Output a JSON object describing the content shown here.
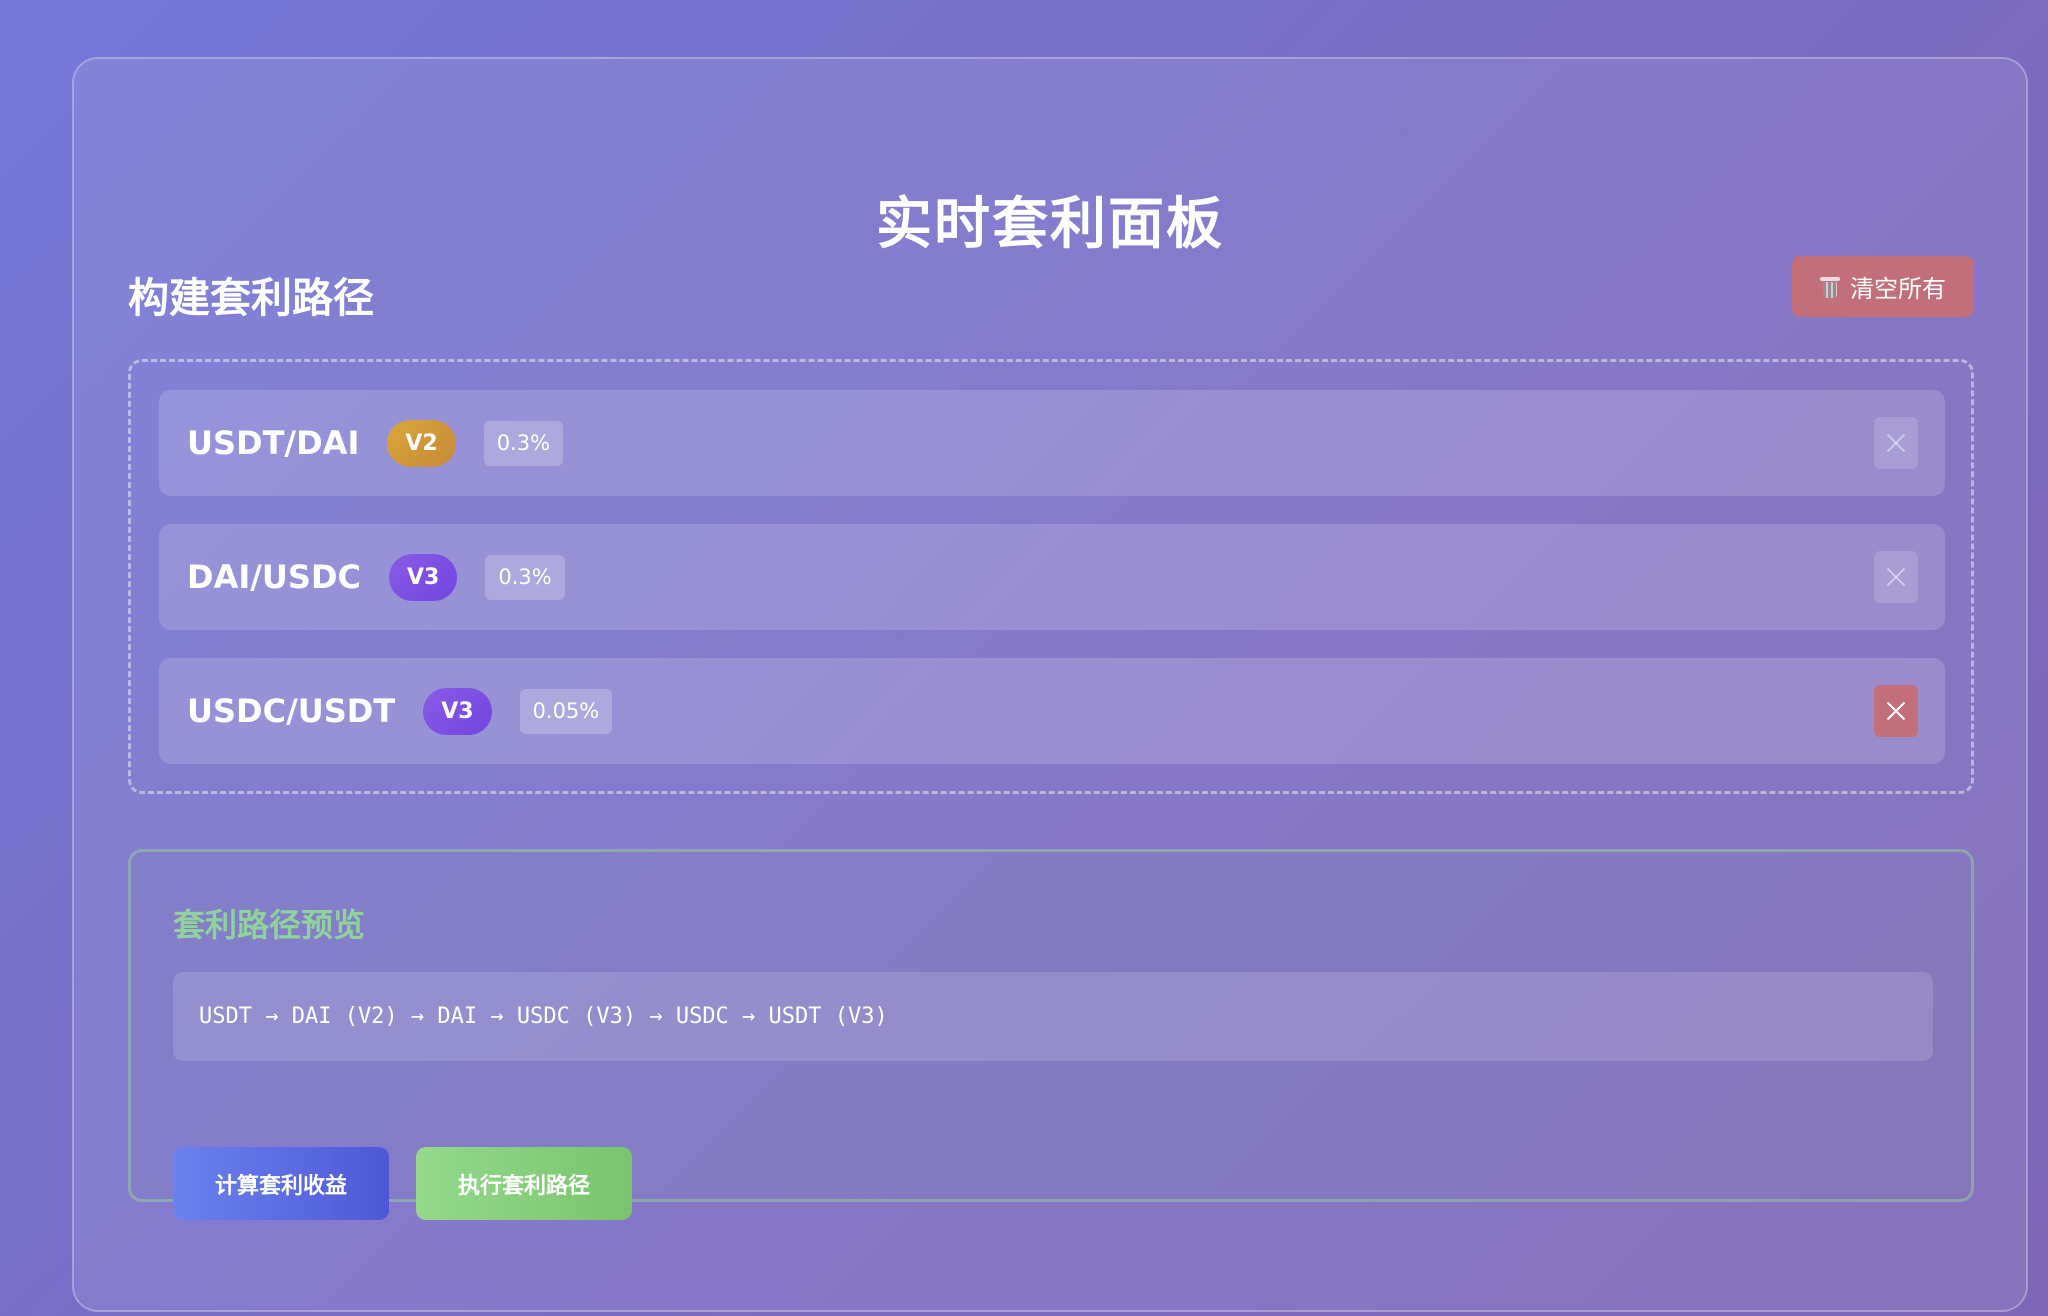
{
  "header": {
    "title": "实时套利面板"
  },
  "builder": {
    "title": "构建套利路径",
    "clear_label": "清空所有",
    "hops": [
      {
        "pair": "USDT/DAI",
        "version": "V2",
        "fee": "0.3%"
      },
      {
        "pair": "DAI/USDC",
        "version": "V3",
        "fee": "0.3%"
      },
      {
        "pair": "USDC/USDT",
        "version": "V3",
        "fee": "0.05%"
      }
    ]
  },
  "preview": {
    "title": "套利路径预览",
    "path": "USDT → DAI (V2) → DAI → USDC (V3) → USDC → USDT (V3)",
    "calc_label": "计算套利收益",
    "execute_label": "执行套利路径"
  },
  "colors": {
    "accent_danger": "#c26f7a",
    "badge_v2": "#d9a838",
    "badge_v3": "#7d4fe2",
    "preview_title": "#8fd39a",
    "calc_button": "#5a6ce2",
    "execute_button": "#86cf7d"
  }
}
